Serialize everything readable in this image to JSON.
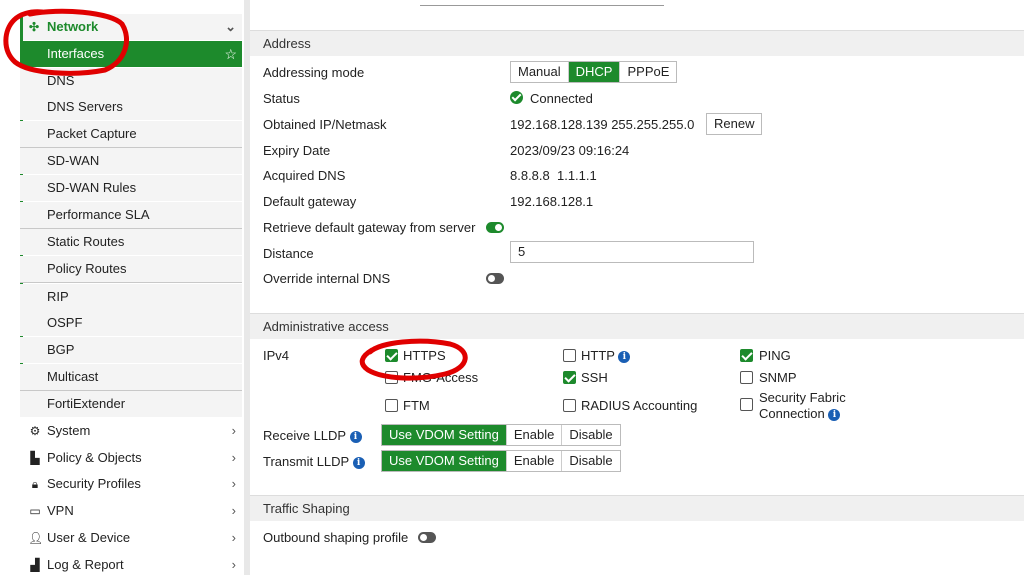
{
  "sidebar": {
    "network_label": "Network",
    "sub_items": [
      {
        "label": "Interfaces"
      },
      {
        "label": "DNS"
      },
      {
        "label": "DNS Servers"
      },
      {
        "label": "Packet Capture"
      },
      {
        "label": "SD-WAN"
      },
      {
        "label": "SD-WAN Rules"
      },
      {
        "label": "Performance SLA"
      },
      {
        "label": "Static Routes"
      },
      {
        "label": "Policy Routes"
      },
      {
        "label": "RIP"
      },
      {
        "label": "OSPF"
      },
      {
        "label": "BGP"
      },
      {
        "label": "Multicast"
      },
      {
        "label": "FortiExtender"
      }
    ],
    "top_items": [
      {
        "label": "System",
        "icon": "gear-icon"
      },
      {
        "label": "Policy & Objects",
        "icon": "policy-icon"
      },
      {
        "label": "Security Profiles",
        "icon": "lock-icon"
      },
      {
        "label": "VPN",
        "icon": "laptop-icon"
      },
      {
        "label": "User & Device",
        "icon": "user-icon"
      },
      {
        "label": "Log & Report",
        "icon": "chart-icon"
      }
    ]
  },
  "address": {
    "title": "Address",
    "addressing_mode_label": "Addressing mode",
    "modes": [
      "Manual",
      "DHCP",
      "PPPoE"
    ],
    "selected_mode": "DHCP",
    "status_label": "Status",
    "status_value": "Connected",
    "obtained_label": "Obtained IP/Netmask",
    "obtained_value": "192.168.128.139 255.255.255.0",
    "renew_label": "Renew",
    "expiry_label": "Expiry Date",
    "expiry_value": "2023/09/23 09:16:24",
    "acquired_dns_label": "Acquired DNS",
    "acquired_dns_value": "8.8.8.8  1.1.1.1",
    "gateway_label": "Default gateway",
    "gateway_value": "192.168.128.1",
    "retrieve_label": "Retrieve default gateway from server",
    "retrieve_on": true,
    "distance_label": "Distance",
    "distance_value": "5",
    "override_dns_label": "Override internal DNS",
    "override_dns_on": false
  },
  "admin": {
    "title": "Administrative access",
    "ipv4_label": "IPv4",
    "options": {
      "https": {
        "label": "HTTPS",
        "checked": true
      },
      "fmg": {
        "label": "FMG-Access",
        "checked": false
      },
      "ftm": {
        "label": "FTM",
        "checked": false
      },
      "http": {
        "label": "HTTP",
        "checked": false
      },
      "ssh": {
        "label": "SSH",
        "checked": true
      },
      "radius": {
        "label": "RADIUS Accounting",
        "checked": false
      },
      "ping": {
        "label": "PING",
        "checked": true
      },
      "snmp": {
        "label": "SNMP",
        "checked": false
      },
      "fabric_line1": "Security Fabric",
      "fabric_line2": "Connection"
    },
    "receive_lldp_label": "Receive LLDP",
    "transmit_lldp_label": "Transmit LLDP",
    "lldp_options": [
      "Use VDOM Setting",
      "Enable",
      "Disable"
    ]
  },
  "traffic": {
    "title": "Traffic Shaping",
    "outbound_label": "Outbound shaping profile",
    "outbound_on": false
  },
  "colors": {
    "accent": "#1d8a2c",
    "annotation": "#e00000"
  }
}
